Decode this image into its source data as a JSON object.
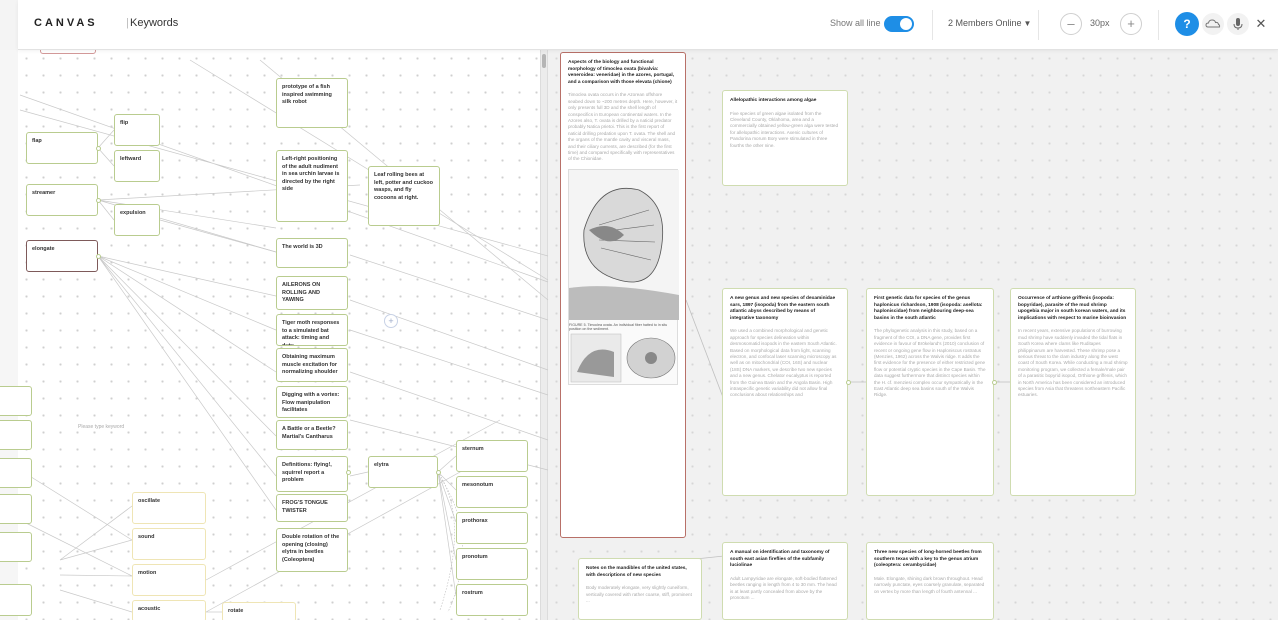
{
  "header": {
    "logo": "CANVAS",
    "separator": "|",
    "page_title": "Keywords",
    "show_all_label": "Show all line",
    "members_label": "2 Members Online",
    "members_chevron": "▼",
    "zoom_out": "–",
    "zoom_value": "30px",
    "zoom_in": "+",
    "help": "?",
    "close": "✕"
  },
  "canvas": {
    "placeholder": "Please type keyword",
    "add": "+"
  },
  "keywords": {
    "flap": "flap",
    "flip": "flip",
    "leftward": "leftward",
    "streamer": "streamer",
    "expulsion": "expulsion",
    "elongate": "elongate",
    "oscillate": "oscillate",
    "sound": "sound",
    "motion": "motion",
    "acoustic": "acoustic",
    "rotate": "rotate",
    "elytra": "elytra",
    "sternum": "sternum",
    "mesonotum": "mesonotum",
    "prothorax": "prothorax",
    "pronotum": "pronotum",
    "rostrum": "rostrum",
    "prototype": "prototype of a fish inspired swimming silk robot",
    "left_right": "Left-right positioning of the adult nudiment in sea urchin larvae is directed by the right side",
    "leaf_rolling": "Leaf rolling bees at left, potter and cuckoo wasps, and fly cocoons at right.",
    "world_3d": "The world is 3D",
    "ailerons": "AILERONS ON ROLLING AND YAWING",
    "tiger_moth": "Tiger moth responses to a simulated bat attack: timing and duty",
    "obtaining": "Obtaining maximum muscle excitation for normalizing shoulder",
    "digging": "Digging with a vortex: Flow manipulation facilitates",
    "battle_beetle": "A Battle or a Beetle? Martial's Cantharus",
    "definitions": "Definitions: flying!, squirrel report a problem",
    "frogs_tongue": "FROG'S TONGUE TWISTER",
    "double_rotation": "Double rotation of the opening (closing) elytra in beetles (Coleoptera)"
  },
  "papers": {
    "timoclea": {
      "title": "Aspects of the biology and functional morphology of timoclea ovata (bivalvia: veneroidea: veneridae) in the azores, portugal, and a comparison with those elevata (chione)",
      "abstract": "Timoclea ovata occurs in the Azorean offshore seabed down to ~200 metres depth. Here, however, it only presents full 3D and the shell length of conspecifics in European continental waters. In the Azores also, T. ovata is drilled by a naticid predator probably Natica prietoi. This is the first report of naticid drilling predation upon T. ovata. The shell and the organs of the mantle cavity and visceral mass, and their ciliary currents, are described (for the first time) and compared specifically with representatives of the Chionidae.",
      "figure_caption": "FIGURE 5. Timoclea ovata. An individual fiber hatted to in situ position on the sediment."
    },
    "allelopathic": {
      "title": "Allelopathic interactions among algae",
      "abstract": "Five species of green algae isolated from the Cleveland County, Oklahoma, area and a commercially obtained yellow-green alga were tested for allelopathic interactions. Axenic cultures of Pandorina morum Bory were stimulated in three fourths the other nine."
    },
    "dexaminid": {
      "title": "A new genus and new species of dexaminidae sars, 1897 (isopoda) from the eastern south atlantic abyss described by means of integrative taxonomy",
      "abstract": "We used a combined morphological and genetic approach for species delineation within desmosomatid isopods in the eastern South Atlantic. Based on morphological data from light, scanning electron, and confocal laser scanning microscopy as well as on mitochondrial (COI, 16S) and nuclear (18S) DNA markers, we describe two new species and a new genus. Chelator eucalyptus is reported from the Guinea Basin and the Angola Basin. High intraspecific genetic variability did not allow final conclusions about relationships and"
    },
    "haplonicus": {
      "title": "First genetic data for species of the genus haplonicus richardson, 1908 (isopoda: asellota: haploniscidae) from neighbouring deep-sea basins in the south atlantic",
      "abstract": "The phylogenetic analysis in this study, based on a fragment of the COI, a DNA gene, provides first evidence in favour of Brökeland's (2010) conclusion of recent or ongoing gene flow in Haploniscus rostratus (Menzies, 1962) across the Walvis ridge. It adds the first evidence for the presence of either restricted gene flow or potential cryptic species in the Cape Basin. The data suggest furthermore that distinct species within the H. cf. menziesi complex occur sympatrically in the East Atlantic deep sea basins south of the Walvis Ridge."
    },
    "arthione": {
      "title": "Occurrence of arthione griffenis (isopoda: bopyridae), parasite of the mud shrimp upogebia major in south korean waters, and its implications with respect to marine bioinvasion",
      "abstract": "In recent years, extensive populations of burrowing mud shrimp have suddenly invaded the tidal flats in South Korea where clams like Ruditapes philippinarum are harvested. These shrimp pose a serious threat to the clam industry along the west coast of South Korea. While conducting a mud shrimp monitoring program, we collected a female/male pair of a parasitic bopyrid isopod, Orthione griffenis, which in North America has been considered an introduced species from Asia that threatens northeastern Pacific estuaries."
    },
    "mandibles": {
      "title": "Notes on the mandibles of the united states, with descriptions of new species",
      "abstract": "Body moderately elongate, very slightly cuneiform, vertically covered with rather coarse, stiff, prominent ..."
    },
    "fireflies": {
      "title": "A manual on identification and taxonomy of south east asian fireflies of the subfamily luciolinae",
      "abstract": "Adult Lampyridae are elongate, soft-bodied flattened beetles ranging in length from 4 to 30 mm. The head is at least partly concealed from above by the pronotum ..."
    },
    "longhorned": {
      "title": "Three new species of long-horned beetles from southern texas with a key to the genus atrium (coleoptera: cerambycidae)",
      "abstract": "Male. Elongate, shining dark brown throughout. Head narrowly punctate, eyes coarsely granulate, separated on vertex by more than length of fourth antennal ..."
    }
  },
  "colors": {
    "accent": "#1e8ee6",
    "keyword_border": "#b9cc8f",
    "active_border": "#b87068",
    "connector": "#c8c8c8"
  }
}
